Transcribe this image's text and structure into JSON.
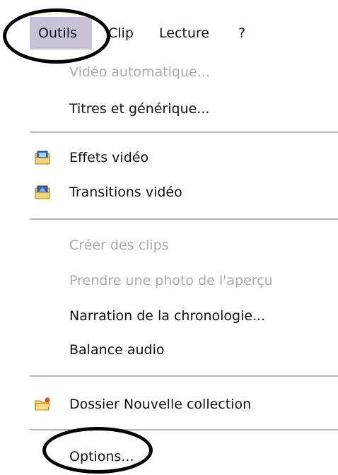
{
  "menubar": {
    "items": [
      {
        "label": "Outils"
      },
      {
        "label": "Clip"
      },
      {
        "label": "Lecture"
      },
      {
        "label": "?"
      }
    ]
  },
  "dropdown": {
    "items": [
      {
        "label": "Vidéo automatique...",
        "enabled": false
      },
      {
        "label": "Titres et générique...",
        "enabled": true
      },
      {
        "label": "Effets vidéo",
        "enabled": true,
        "icon": "video-effects-icon"
      },
      {
        "label": "Transitions vidéo",
        "enabled": true,
        "icon": "video-transitions-icon"
      },
      {
        "label": "Créer des clips",
        "enabled": false
      },
      {
        "label": "Prendre une photo de l'aperçu",
        "enabled": false
      },
      {
        "label": "Narration de la chronologie...",
        "enabled": true
      },
      {
        "label": "Balance audio",
        "enabled": true
      },
      {
        "label": "Dossier Nouvelle collection",
        "enabled": true,
        "icon": "new-collection-folder-icon"
      },
      {
        "label": "Options...",
        "enabled": true
      }
    ]
  },
  "colors": {
    "menu_highlight": "#c8c2d8",
    "disabled_text": "#a9a9a9",
    "separator": "#b9b9b9",
    "annotation": "#000000"
  }
}
